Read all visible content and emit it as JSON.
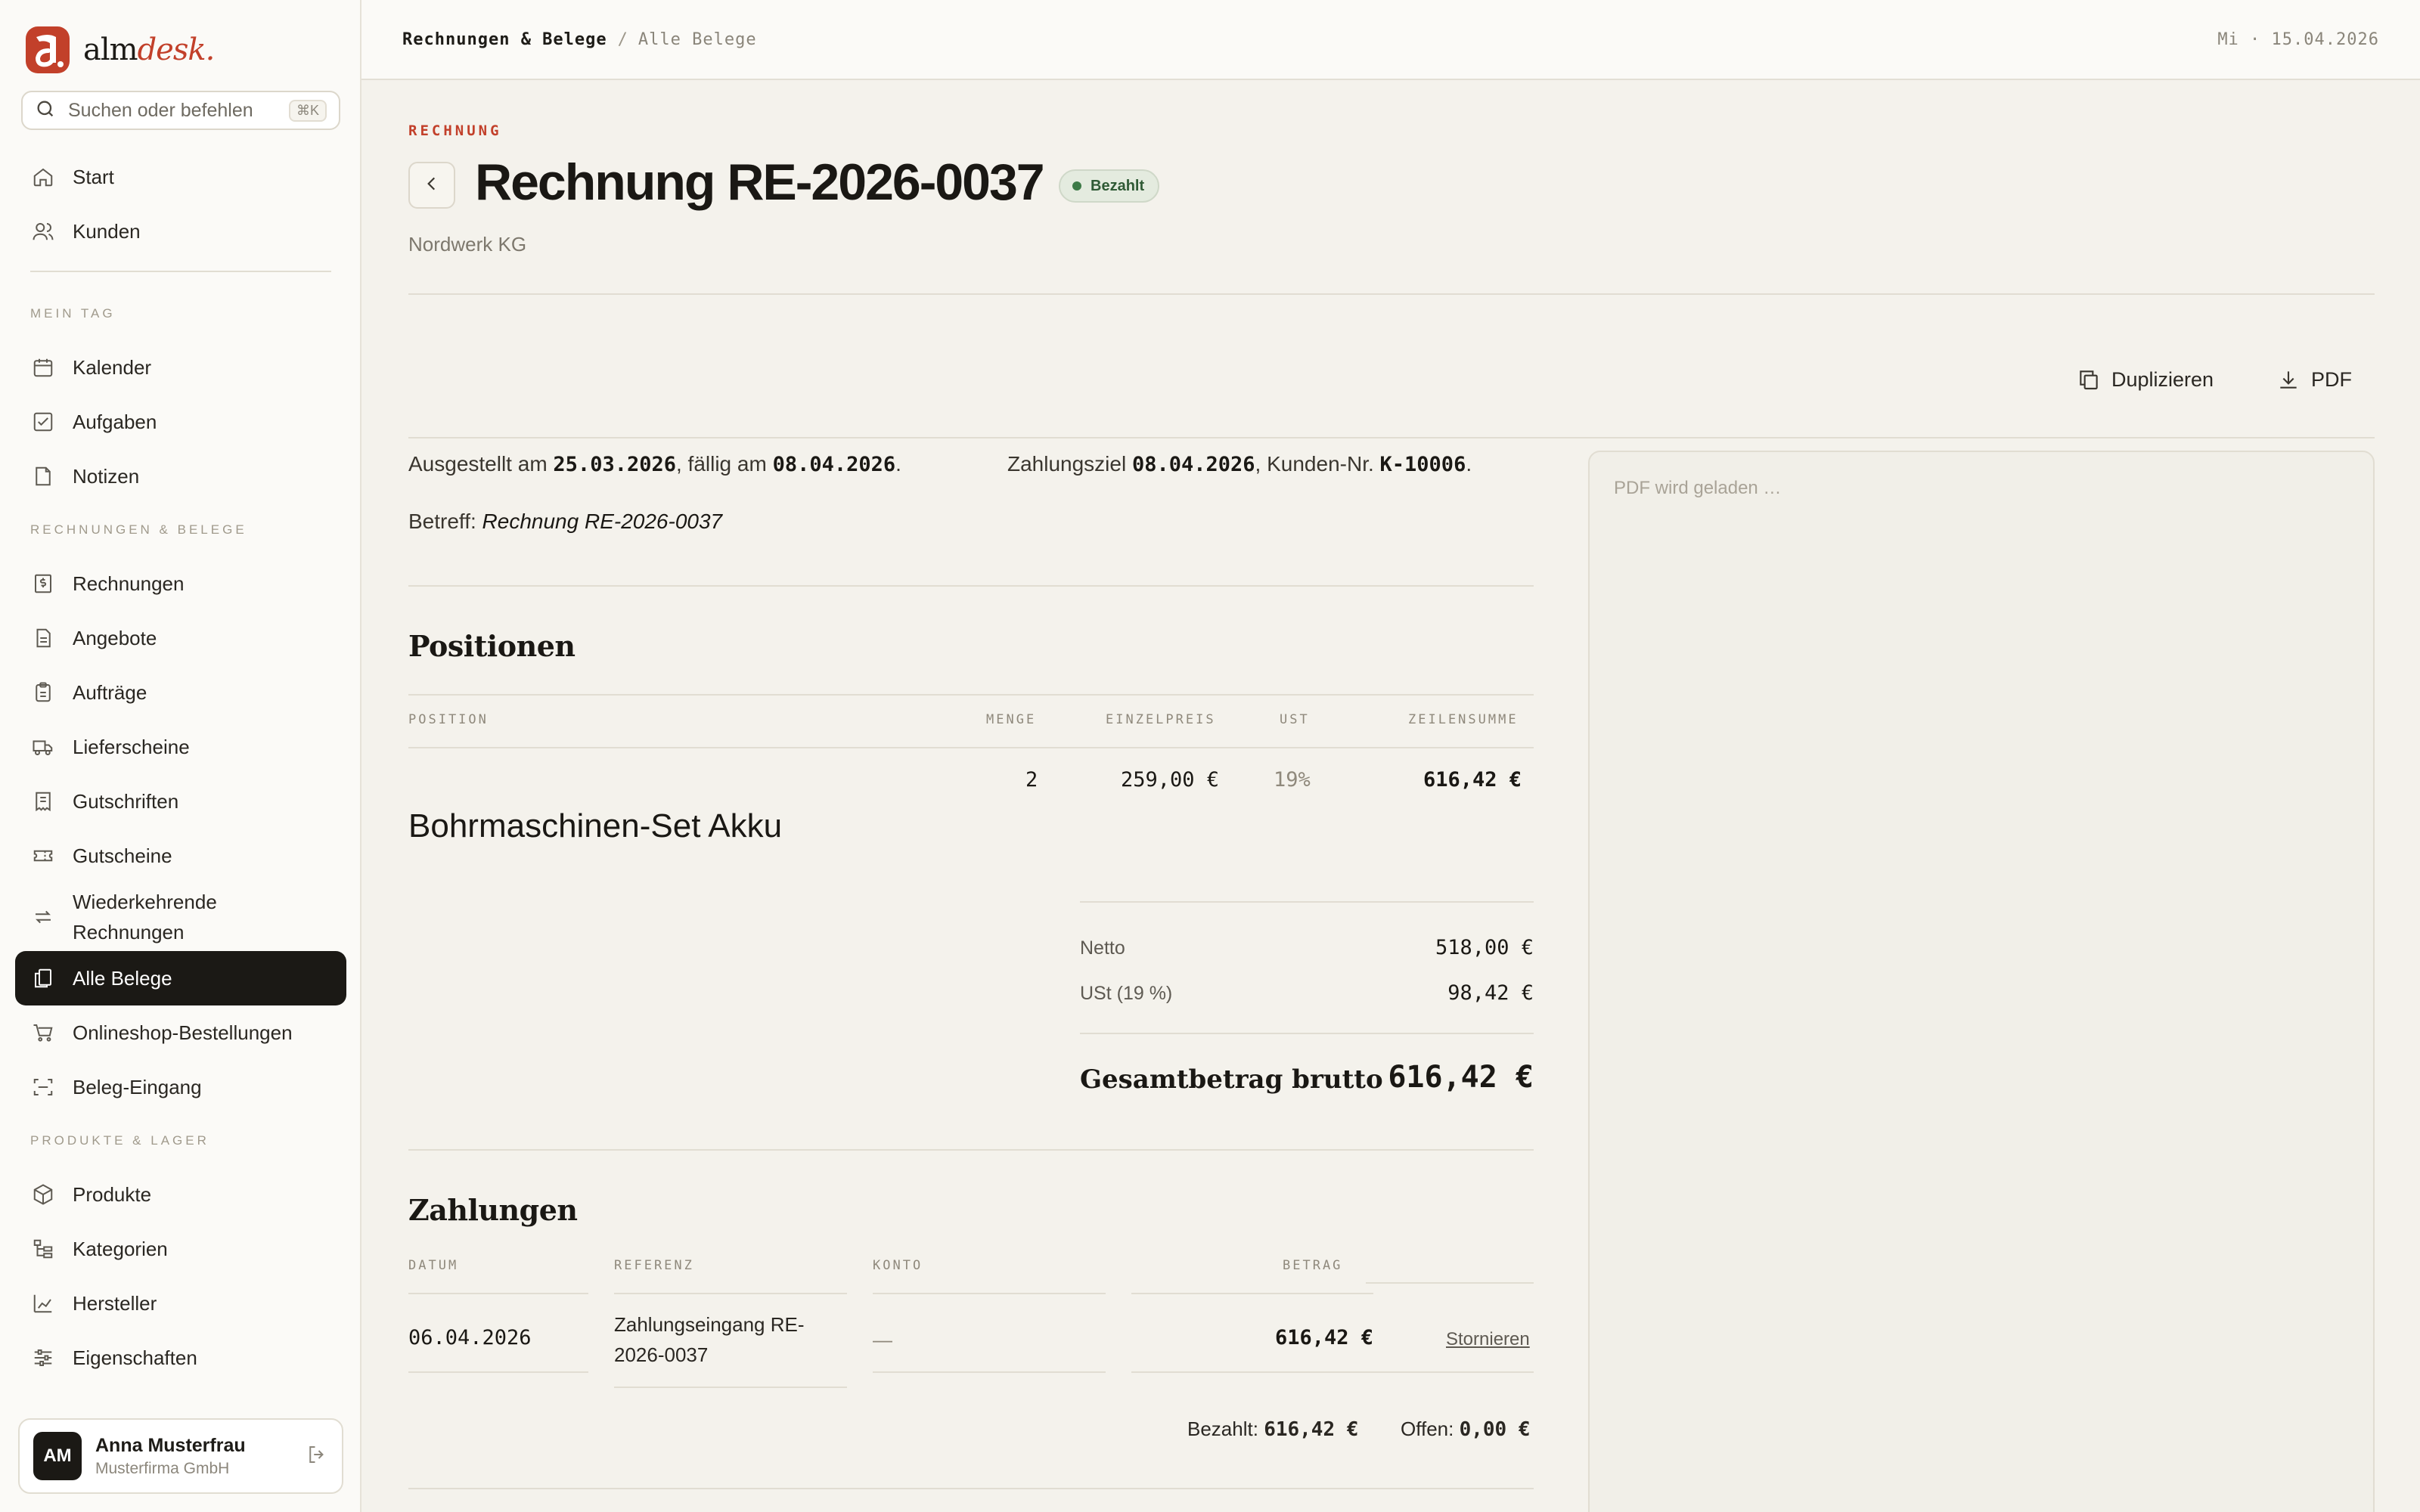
{
  "brand": {
    "name_main": "alm",
    "name_accent": "desk."
  },
  "search": {
    "placeholder": "Suchen oder befehlen",
    "shortcut": "⌘K"
  },
  "sidebar": {
    "top_items": [
      {
        "label": "Start",
        "icon": "home-icon"
      },
      {
        "label": "Kunden",
        "icon": "users-icon"
      }
    ],
    "sections": [
      {
        "title": "MEIN TAG",
        "items": [
          {
            "label": "Kalender",
            "icon": "calendar-icon"
          },
          {
            "label": "Aufgaben",
            "icon": "checkbox-icon"
          },
          {
            "label": "Notizen",
            "icon": "note-icon"
          }
        ]
      },
      {
        "title": "RECHNUNGEN & BELEGE",
        "items": [
          {
            "label": "Rechnungen",
            "icon": "dollar-doc-icon"
          },
          {
            "label": "Angebote",
            "icon": "document-icon"
          },
          {
            "label": "Aufträge",
            "icon": "clipboard-icon"
          },
          {
            "label": "Lieferscheine",
            "icon": "truck-icon"
          },
          {
            "label": "Gutschriften",
            "icon": "receipt-icon"
          },
          {
            "label": "Gutscheine",
            "icon": "ticket-icon"
          },
          {
            "label": "Wiederkehrende Rechnungen",
            "label_line1": "Wiederkehrende",
            "label_line2": "Rechnungen",
            "icon": "repeat-icon"
          },
          {
            "label": "Alle Belege",
            "icon": "copy-icon",
            "active": true
          },
          {
            "label": "Onlineshop-Bestellungen",
            "icon": "cart-icon"
          },
          {
            "label": "Beleg-Eingang",
            "icon": "scan-icon"
          }
        ]
      },
      {
        "title": "PRODUKTE & LAGER",
        "items": [
          {
            "label": "Produkte",
            "icon": "box-icon"
          },
          {
            "label": "Kategorien",
            "icon": "tree-icon"
          },
          {
            "label": "Hersteller",
            "icon": "factory-icon"
          },
          {
            "label": "Eigenschaften",
            "icon": "sliders-icon"
          }
        ]
      }
    ]
  },
  "user": {
    "initials": "AM",
    "name": "Anna Musterfrau",
    "org": "Musterfirma GmbH"
  },
  "topbar": {
    "crumb_parent": "Rechnungen & Belege",
    "crumb_sep": "/",
    "crumb_current": "Alle Belege",
    "date": "Mi · 15.04.2026"
  },
  "invoice": {
    "eyebrow": "RECHNUNG",
    "title": "Rechnung RE-2026-0037",
    "status": "Bezahlt",
    "customer": "Nordwerk KG",
    "actions": {
      "duplicate": "Duplizieren",
      "pdf": "PDF"
    },
    "meta": {
      "issued_label": "Ausgestellt am",
      "issued": "25.03.2026",
      "due_label": ", fällig am",
      "due": "08.04.2026",
      "term_label": "Zahlungsziel",
      "term": "08.04.2026",
      "customer_no_label": ", Kunden-Nr.",
      "customer_no": "K-10006",
      "subject_label": "Betreff:",
      "subject": "Rechnung RE-2026-0037"
    },
    "positions": {
      "heading": "Positionen",
      "columns": [
        "POSITION",
        "MENGE",
        "EINZELPREIS",
        "UST",
        "ZEILENSUMME"
      ],
      "rows": [
        {
          "name": "Bohrmaschinen-Set Akku",
          "qty": "2",
          "unit_price": "259,00 €",
          "vat": "19%",
          "line_total": "616,42 €"
        }
      ]
    },
    "totals": {
      "net_label": "Netto",
      "net": "518,00 €",
      "vat_label": "USt (19 %)",
      "vat": "98,42 €",
      "gross_label": "Gesamtbetrag brutto",
      "gross": "616,42 €"
    },
    "payments": {
      "heading": "Zahlungen",
      "columns": [
        "DATUM",
        "REFERENZ",
        "KONTO",
        "BETRAG"
      ],
      "rows": [
        {
          "date": "06.04.2026",
          "reference_line1": "Zahlungseingang RE-",
          "reference_line2": "2026-0037",
          "account": "—",
          "amount": "616,42 €",
          "action": "Stornieren"
        }
      ],
      "paid_label": "Bezahlt:",
      "paid": "616,42 €",
      "open_label": "Offen:",
      "open": "0,00 €"
    },
    "pdf_loading": "PDF wird geladen …"
  },
  "colors": {
    "accent": "#c2402a",
    "status_green": "#3d7a47",
    "active_nav": "#1b1915"
  }
}
